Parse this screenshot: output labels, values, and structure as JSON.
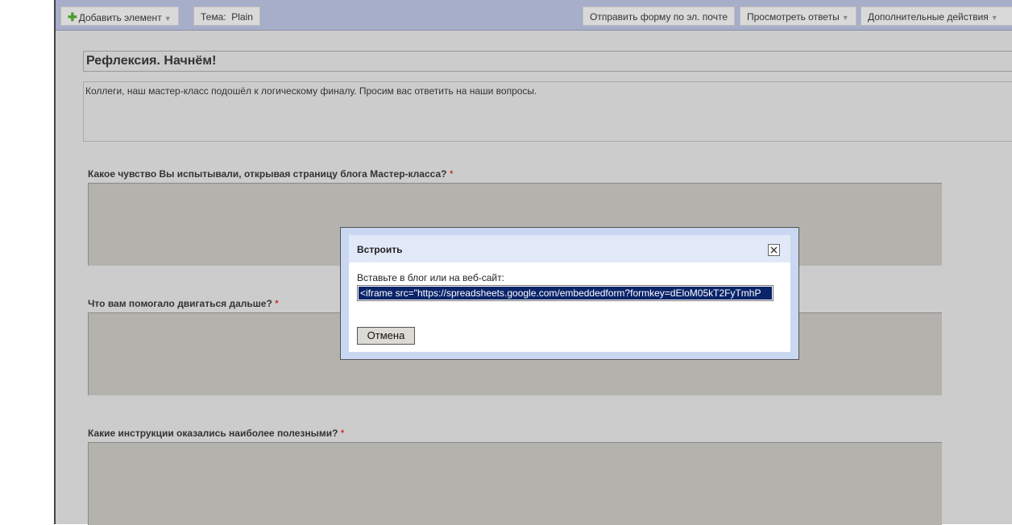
{
  "toolbar": {
    "add_item": "Добавить элемент",
    "theme_label": "Тема:",
    "theme_value": "Plain",
    "email_form": "Отправить форму по эл. почте",
    "view_responses": "Просмотреть ответы",
    "more_actions": "Дополнительные действия"
  },
  "form": {
    "title": "Рефлексия. Начнём!",
    "description": "Коллеги, наш мастер-класс подошёл к логическому финалу. Просим вас ответить на наши вопросы.",
    "required_mark": "*",
    "questions": [
      {
        "label": "Какое чувство Вы испытывали, открывая страницу блога Мастер-класса?"
      },
      {
        "label": "Что вам помогало двигаться дальше?"
      },
      {
        "label": "Какие инструкции оказались наиболее полезными?"
      }
    ]
  },
  "dialog": {
    "title": "Встроить",
    "embed_label": "Вставьте в блог или на веб-сайт:",
    "embed_code": "<iframe src=\"https://spreadsheets.google.com/embeddedform?formkey=dEloM05kT2FyTmhP",
    "cancel": "Отмена"
  },
  "icons": {
    "add": "plus-icon",
    "dropdown": "chevron-down-icon",
    "close": "close-icon"
  },
  "colors": {
    "toolbar": "#a7aec9",
    "dialog_header": "#e1e9f8",
    "selection": "#0a246a",
    "required": "#cc0000"
  }
}
